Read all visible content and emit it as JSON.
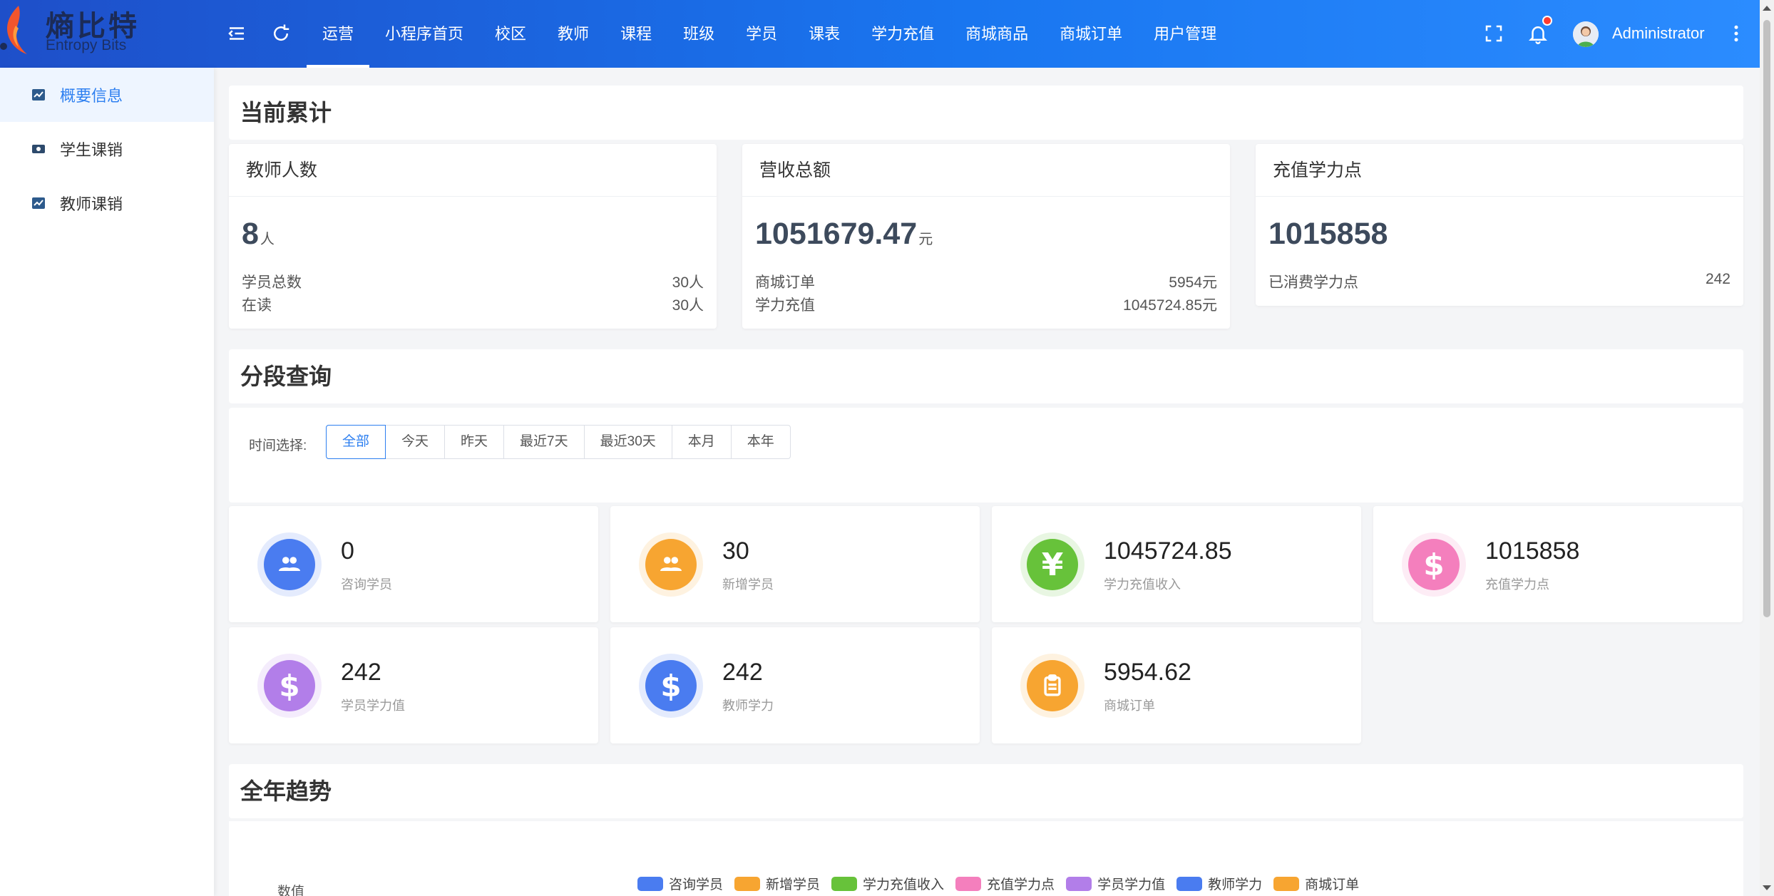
{
  "app": {
    "logo_name": "熵比特",
    "logo_sub": "Entropy Bits"
  },
  "nav": {
    "items": [
      {
        "label": "运营",
        "active": true
      },
      {
        "label": "小程序首页"
      },
      {
        "label": "校区"
      },
      {
        "label": "教师"
      },
      {
        "label": "课程"
      },
      {
        "label": "班级"
      },
      {
        "label": "学员"
      },
      {
        "label": "课表"
      },
      {
        "label": "学力充值"
      },
      {
        "label": "商城商品"
      },
      {
        "label": "商城订单"
      },
      {
        "label": "用户管理"
      }
    ],
    "username": "Administrator",
    "notification": true
  },
  "sidebar": {
    "items": [
      {
        "label": "概要信息",
        "icon": "chart-icon",
        "active": true
      },
      {
        "label": "学生课销",
        "icon": "money-icon"
      },
      {
        "label": "教师课销",
        "icon": "chart-icon"
      }
    ]
  },
  "summary": {
    "title": "当前累计",
    "teachers": {
      "title": "教师人数",
      "value": "8",
      "unit": "人",
      "rows": [
        {
          "k": "学员总数",
          "v": "30人"
        },
        {
          "k": "在读",
          "v": "30人"
        }
      ]
    },
    "revenue": {
      "title": "营收总额",
      "value": "1051679.47",
      "unit": "元",
      "rows": [
        {
          "k": "商城订单",
          "v": "5954元"
        },
        {
          "k": "学力充值",
          "v": "1045724.85元"
        }
      ]
    },
    "recharge": {
      "title": "充值学力点",
      "value": "1015858",
      "rows": [
        {
          "k": "已消费学力点",
          "v": "242"
        }
      ]
    }
  },
  "period": {
    "title": "分段查询",
    "filter_label": "时间选择:",
    "options": [
      "全部",
      "今天",
      "昨天",
      "最近7天",
      "最近30天",
      "本月",
      "本年"
    ],
    "selected": "全部"
  },
  "stats": [
    {
      "value": "0",
      "label": "咨询学员",
      "icon": "users-icon",
      "color": "#4a7cf0"
    },
    {
      "value": "30",
      "label": "新增学员",
      "icon": "users-icon",
      "color": "#f7a531"
    },
    {
      "value": "1045724.85",
      "label": "学力充值收入",
      "icon": "yen-icon",
      "color": "#67c23a"
    },
    {
      "value": "1015858",
      "label": "充值学力点",
      "icon": "dollar-icon",
      "color": "#f47fbd"
    },
    {
      "value": "242",
      "label": "学员学力值",
      "icon": "dollar-icon",
      "color": "#b27ee9"
    },
    {
      "value": "242",
      "label": "教师学力",
      "icon": "dollar-icon",
      "color": "#4a7cf0"
    },
    {
      "value": "5954.62",
      "label": "商城订单",
      "icon": "clipboard-icon",
      "color": "#f7a531"
    }
  ],
  "trend": {
    "title": "全年趋势",
    "ylabel": "数值",
    "legend": [
      {
        "name": "咨询学员",
        "color": "#4a7cf0"
      },
      {
        "name": "新增学员",
        "color": "#f7a531"
      },
      {
        "name": "学力充值收入",
        "color": "#67c23a"
      },
      {
        "name": "充值学力点",
        "color": "#f47fbd"
      },
      {
        "name": "学员学力值",
        "color": "#b27ee9"
      },
      {
        "name": "教师学力",
        "color": "#4a7cf0"
      },
      {
        "name": "商城订单",
        "color": "#f7a531"
      }
    ]
  }
}
